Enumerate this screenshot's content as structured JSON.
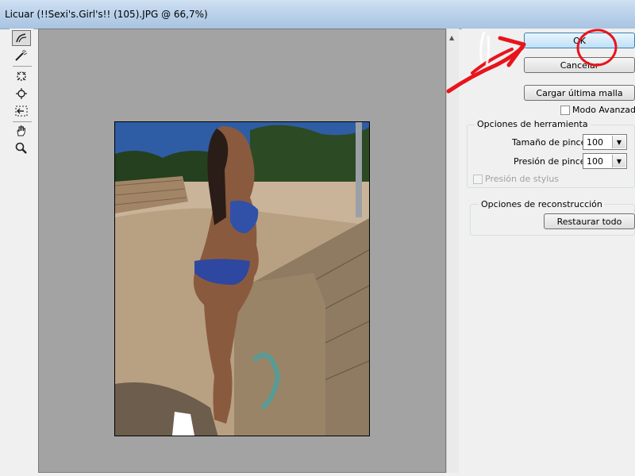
{
  "window": {
    "title": "Licuar (!!Sexi's.Girl's!! (105).JPG @ 66,7%)"
  },
  "tools": [
    {
      "icon": "forward-warp-icon",
      "active": true
    },
    {
      "icon": "reconstruct-icon"
    },
    {
      "icon": "pucker-icon"
    },
    {
      "icon": "bloat-icon"
    },
    {
      "icon": "push-left-icon"
    },
    {
      "icon": "hand-icon"
    },
    {
      "icon": "zoom-icon"
    }
  ],
  "buttons": {
    "ok": "OK",
    "cancel": "Cancelar",
    "load_mesh": "Cargar última malla",
    "restore_all": "Restaurar todo"
  },
  "advanced_mode": {
    "label": "Modo Avanzado",
    "checked": false
  },
  "tool_options": {
    "title": "Opciones de herramienta",
    "brush_size": {
      "label": "Tamaño de pincel:",
      "value": "100"
    },
    "brush_pressure": {
      "label": "Presión de pincel:",
      "value": "100"
    },
    "stylus_pressure": {
      "label": "Presión de stylus",
      "checked": false,
      "disabled": true
    }
  },
  "reconstruction_options": {
    "title": "Opciones de reconstrucción"
  },
  "colors": {
    "annotation_red": "#e8141c",
    "preview_bg": "#a3a3a3",
    "titlebar": "#b9d1ea"
  }
}
